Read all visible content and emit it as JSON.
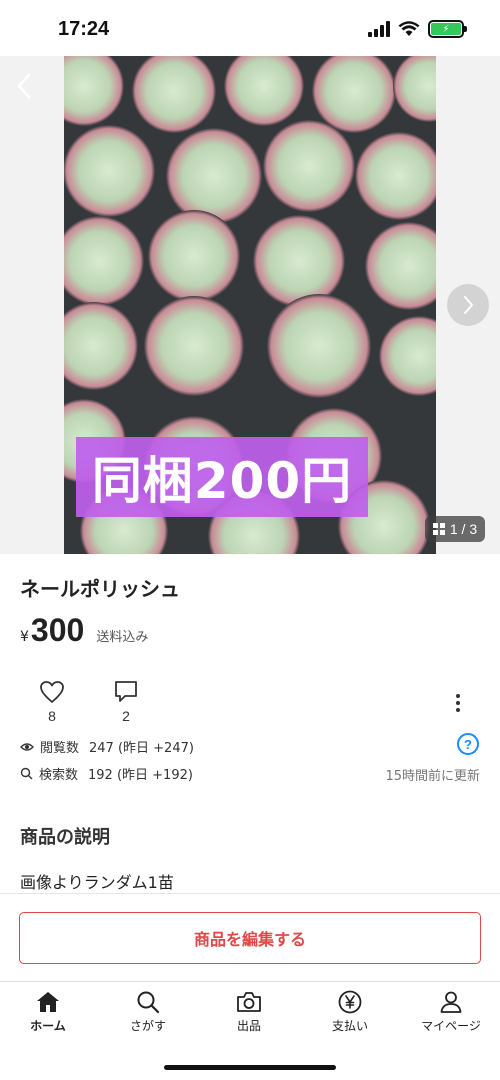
{
  "status_bar": {
    "time": "17:24",
    "battery_color": "#34c759"
  },
  "gallery": {
    "overlay_text": "同梱200円",
    "overlay_color": "#be5feb",
    "counter": "1 / 3",
    "back_icon": "chevron-left-icon",
    "next_icon": "chevron-right-icon"
  },
  "product": {
    "title": "ネールポリッシュ",
    "currency": "¥",
    "price": "300",
    "shipping": "送料込み"
  },
  "actions": {
    "likes": "8",
    "comments": "2"
  },
  "stats": {
    "views_label": "閲覧数",
    "views_value": "247 (昨日 +247)",
    "search_label": "検索数",
    "search_value": "192 (昨日 +192)",
    "help_symbol": "?",
    "updated": "15時間前に更新"
  },
  "description": {
    "heading": "商品の説明",
    "text": "画像よりランダム1苗"
  },
  "edit_button": {
    "label": "商品を編集する",
    "color": "#e04848"
  },
  "tab_bar": {
    "tabs": [
      {
        "label": "ホーム",
        "icon": "home-icon",
        "active": true
      },
      {
        "label": "さがす",
        "icon": "search-icon",
        "active": false
      },
      {
        "label": "出品",
        "icon": "camera-icon",
        "active": false
      },
      {
        "label": "支払い",
        "icon": "yen-coin-icon",
        "active": false
      },
      {
        "label": "マイページ",
        "icon": "person-icon",
        "active": false
      }
    ]
  }
}
